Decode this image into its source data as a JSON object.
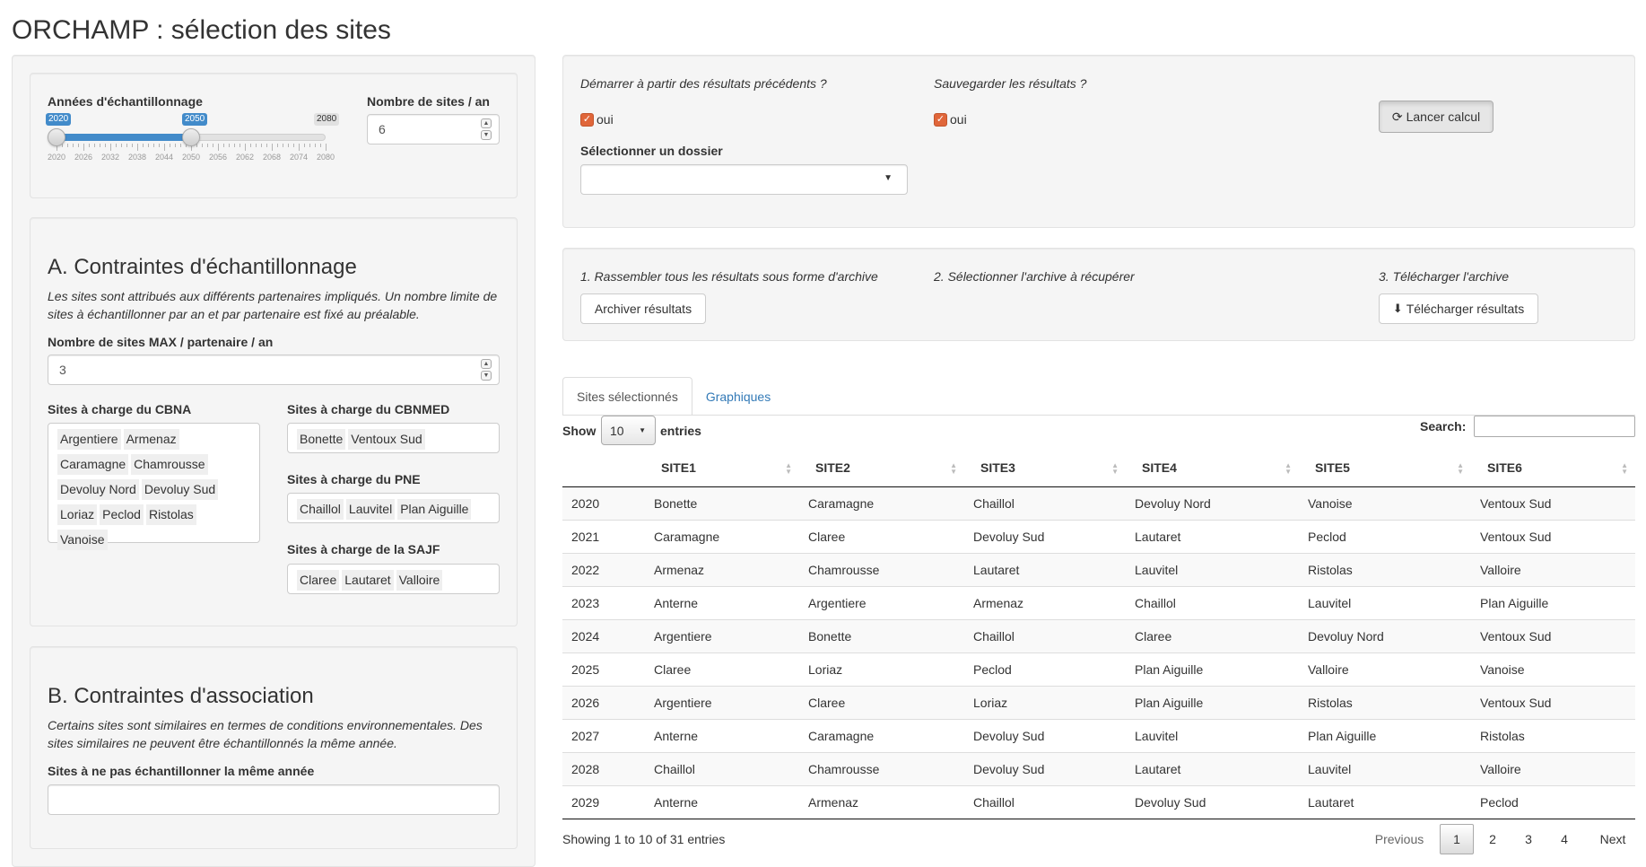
{
  "app": {
    "title": "ORCHAMP : sélection des sites"
  },
  "sampling": {
    "years_label": "Années d'échantillonnage",
    "slider": {
      "min_label": "2020",
      "max_label": "2080",
      "from_label": "2020",
      "to_label": "2050",
      "min": 2020,
      "max": 2080,
      "from": 2020,
      "to": 2050,
      "ticks": [
        "2020",
        "2026",
        "2032",
        "2038",
        "2044",
        "2050",
        "2056",
        "2062",
        "2068",
        "2074",
        "2080"
      ]
    },
    "sites_per_year_label": "Nombre de sites / an",
    "sites_per_year_value": "6"
  },
  "constraints_a": {
    "title": "A. Contraintes d'échantillonnage",
    "description": "Les sites sont attribués aux différents partenaires impliqués. Un nombre limite de sites à échantillonner par an et par partenaire est fixé au préalable.",
    "max_label": "Nombre de sites MAX / partenaire / an",
    "max_value": "3",
    "cbna": {
      "label": "Sites à charge du CBNA",
      "items": [
        "Argentiere",
        "Armenaz",
        "Caramagne",
        "Chamrousse",
        "Devoluy Nord",
        "Devoluy Sud",
        "Loriaz",
        "Peclod",
        "Ristolas",
        "Vanoise"
      ]
    },
    "cbnmed": {
      "label": "Sites à charge du CBNMED",
      "items": [
        "Bonette",
        "Ventoux Sud"
      ]
    },
    "pne": {
      "label": "Sites à charge du PNE",
      "items": [
        "Chaillol",
        "Lauvitel",
        "Plan Aiguille"
      ]
    },
    "sajf": {
      "label": "Sites à charge de la SAJF",
      "items": [
        "Claree",
        "Lautaret",
        "Valloire"
      ]
    }
  },
  "constraints_b": {
    "title": "B. Contraintes d'association",
    "description": "Certains sites sont similaires en termes de conditions environnementales. Des sites similaires ne peuvent être échantillonnés la même année.",
    "field_label": "Sites à ne pas échantillonner la même année",
    "field_value": ""
  },
  "run": {
    "start_label": "Démarrer à partir des résultats précédents ?",
    "start_checkbox": "oui",
    "save_label": "Sauvegarder les résultats ?",
    "save_checkbox": "oui",
    "folder_label": "Sélectionner un dossier",
    "folder_value": "",
    "run_button": "Lancer calcul"
  },
  "archive": {
    "step1": "1. Rassembler tous les résultats sous forme d'archive",
    "step1_button": "Archiver résultats",
    "step2": "2. Sélectionner l'archive à récupérer",
    "step3": "3. Télécharger l'archive",
    "step3_button": "Télécharger résultats"
  },
  "tabs": [
    "Sites sélectionnés",
    "Graphiques"
  ],
  "table": {
    "show_label": "Show",
    "show_value": "10",
    "entries_label": "entries",
    "search_label": "Search:",
    "columns": [
      "",
      "SITE1",
      "SITE2",
      "SITE3",
      "SITE4",
      "SITE5",
      "SITE6"
    ],
    "rows": [
      [
        "2020",
        "Bonette",
        "Caramagne",
        "Chaillol",
        "Devoluy Nord",
        "Vanoise",
        "Ventoux Sud"
      ],
      [
        "2021",
        "Caramagne",
        "Claree",
        "Devoluy Sud",
        "Lautaret",
        "Peclod",
        "Ventoux Sud"
      ],
      [
        "2022",
        "Armenaz",
        "Chamrousse",
        "Lautaret",
        "Lauvitel",
        "Ristolas",
        "Valloire"
      ],
      [
        "2023",
        "Anterne",
        "Argentiere",
        "Armenaz",
        "Chaillol",
        "Lauvitel",
        "Plan Aiguille"
      ],
      [
        "2024",
        "Argentiere",
        "Bonette",
        "Chaillol",
        "Claree",
        "Devoluy Nord",
        "Ventoux Sud"
      ],
      [
        "2025",
        "Claree",
        "Loriaz",
        "Peclod",
        "Plan Aiguille",
        "Valloire",
        "Vanoise"
      ],
      [
        "2026",
        "Argentiere",
        "Claree",
        "Loriaz",
        "Plan Aiguille",
        "Ristolas",
        "Ventoux Sud"
      ],
      [
        "2027",
        "Anterne",
        "Caramagne",
        "Devoluy Sud",
        "Lauvitel",
        "Plan Aiguille",
        "Ristolas"
      ],
      [
        "2028",
        "Chaillol",
        "Chamrousse",
        "Devoluy Sud",
        "Lautaret",
        "Lauvitel",
        "Valloire"
      ],
      [
        "2029",
        "Anterne",
        "Armenaz",
        "Chaillol",
        "Devoluy Sud",
        "Lautaret",
        "Peclod"
      ]
    ],
    "info": "Showing 1 to 10 of 31 entries",
    "pagination": {
      "previous": "Previous",
      "pages": [
        "1",
        "2",
        "3",
        "4"
      ],
      "next": "Next",
      "current": "1"
    }
  },
  "colors": {
    "accent": "#428bca",
    "checkbox": "#e0663a",
    "link": "#337ab7"
  }
}
